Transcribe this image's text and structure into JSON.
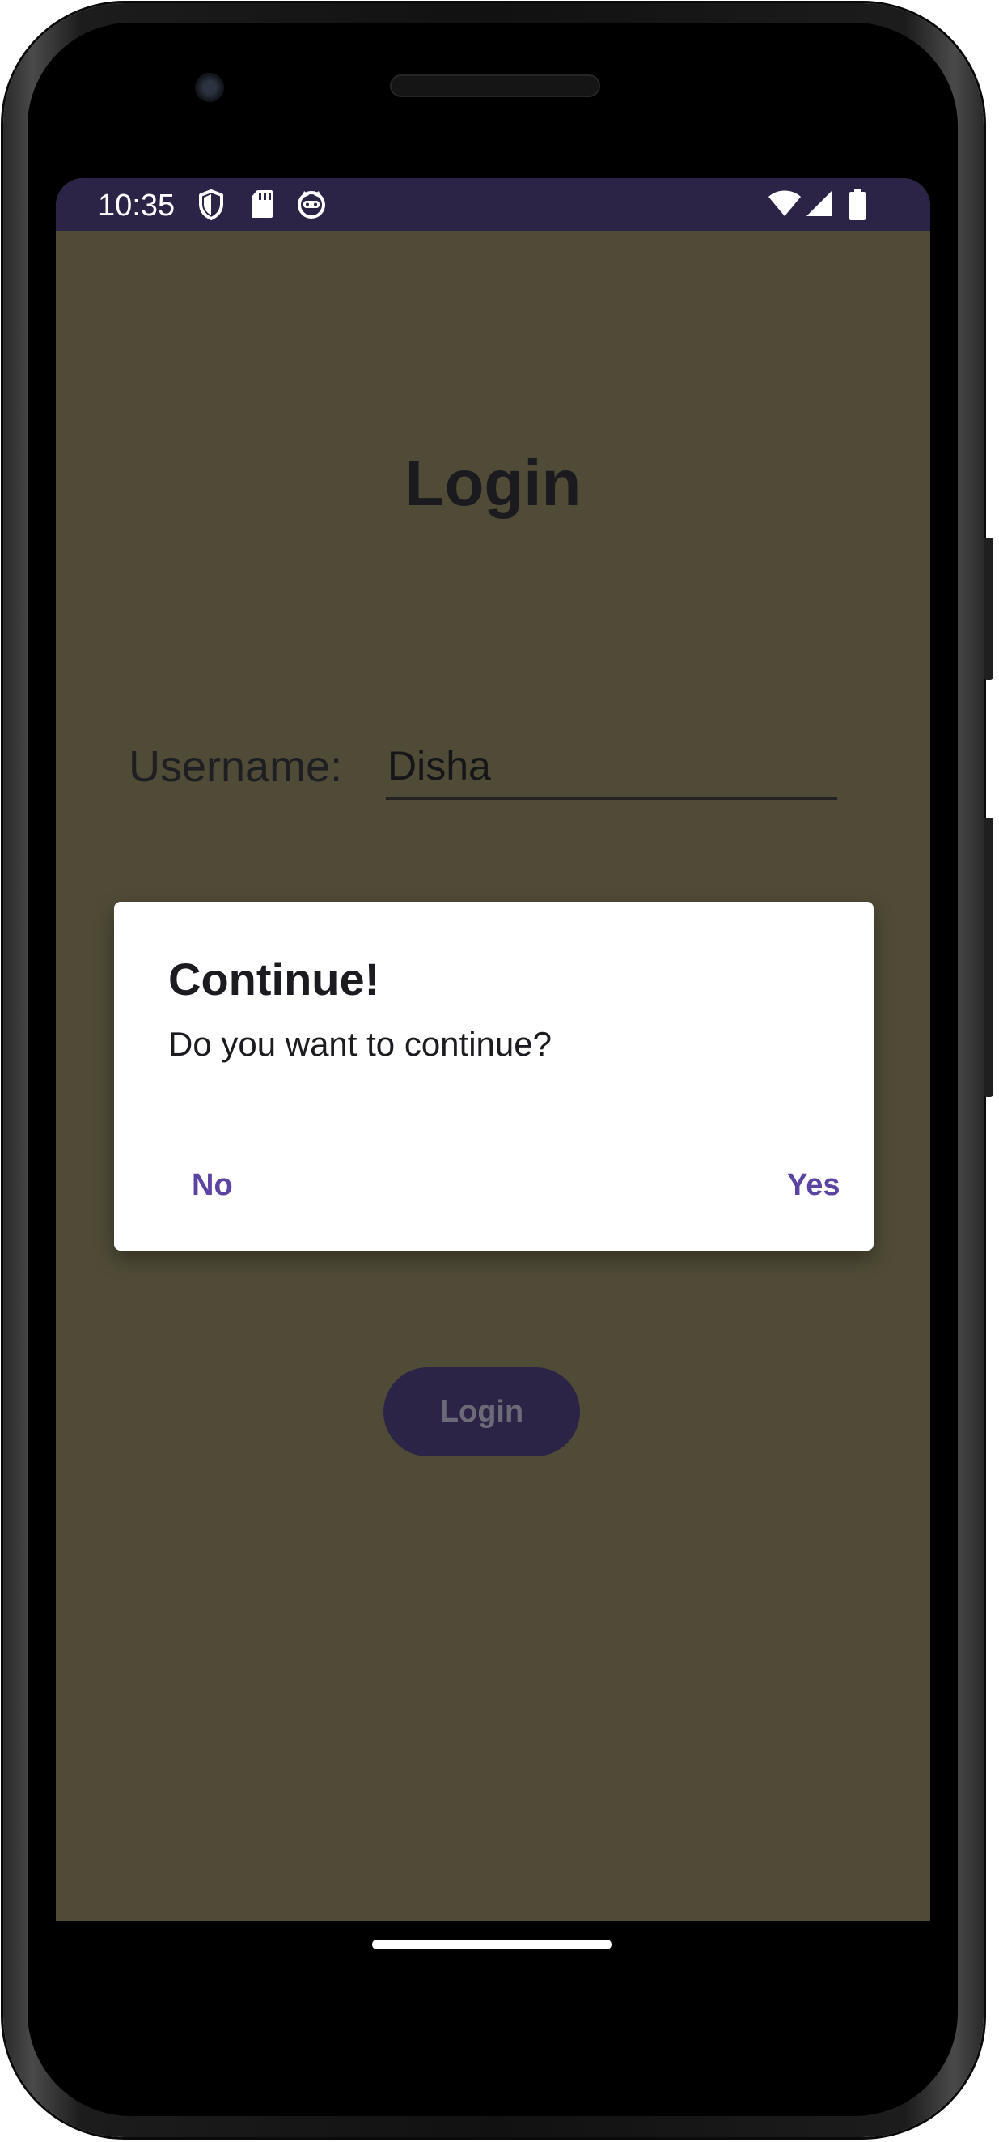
{
  "status_bar": {
    "time": "10:35",
    "left_icons": [
      "shield-icon",
      "sd-card-icon",
      "cat-face-icon"
    ],
    "right_icons": [
      "wifi-icon",
      "cell-signal-icon",
      "battery-icon"
    ],
    "background": "#2c2447"
  },
  "screen": {
    "background": "#4f4b36",
    "title": "Login",
    "username": {
      "label": "Username:",
      "value": "Disha"
    },
    "login_button": "Login"
  },
  "dialog": {
    "title": "Continue!",
    "message": "Do you want to continue?",
    "negative_button": "No",
    "positive_button": "Yes",
    "accent_color": "#5b44a2"
  }
}
